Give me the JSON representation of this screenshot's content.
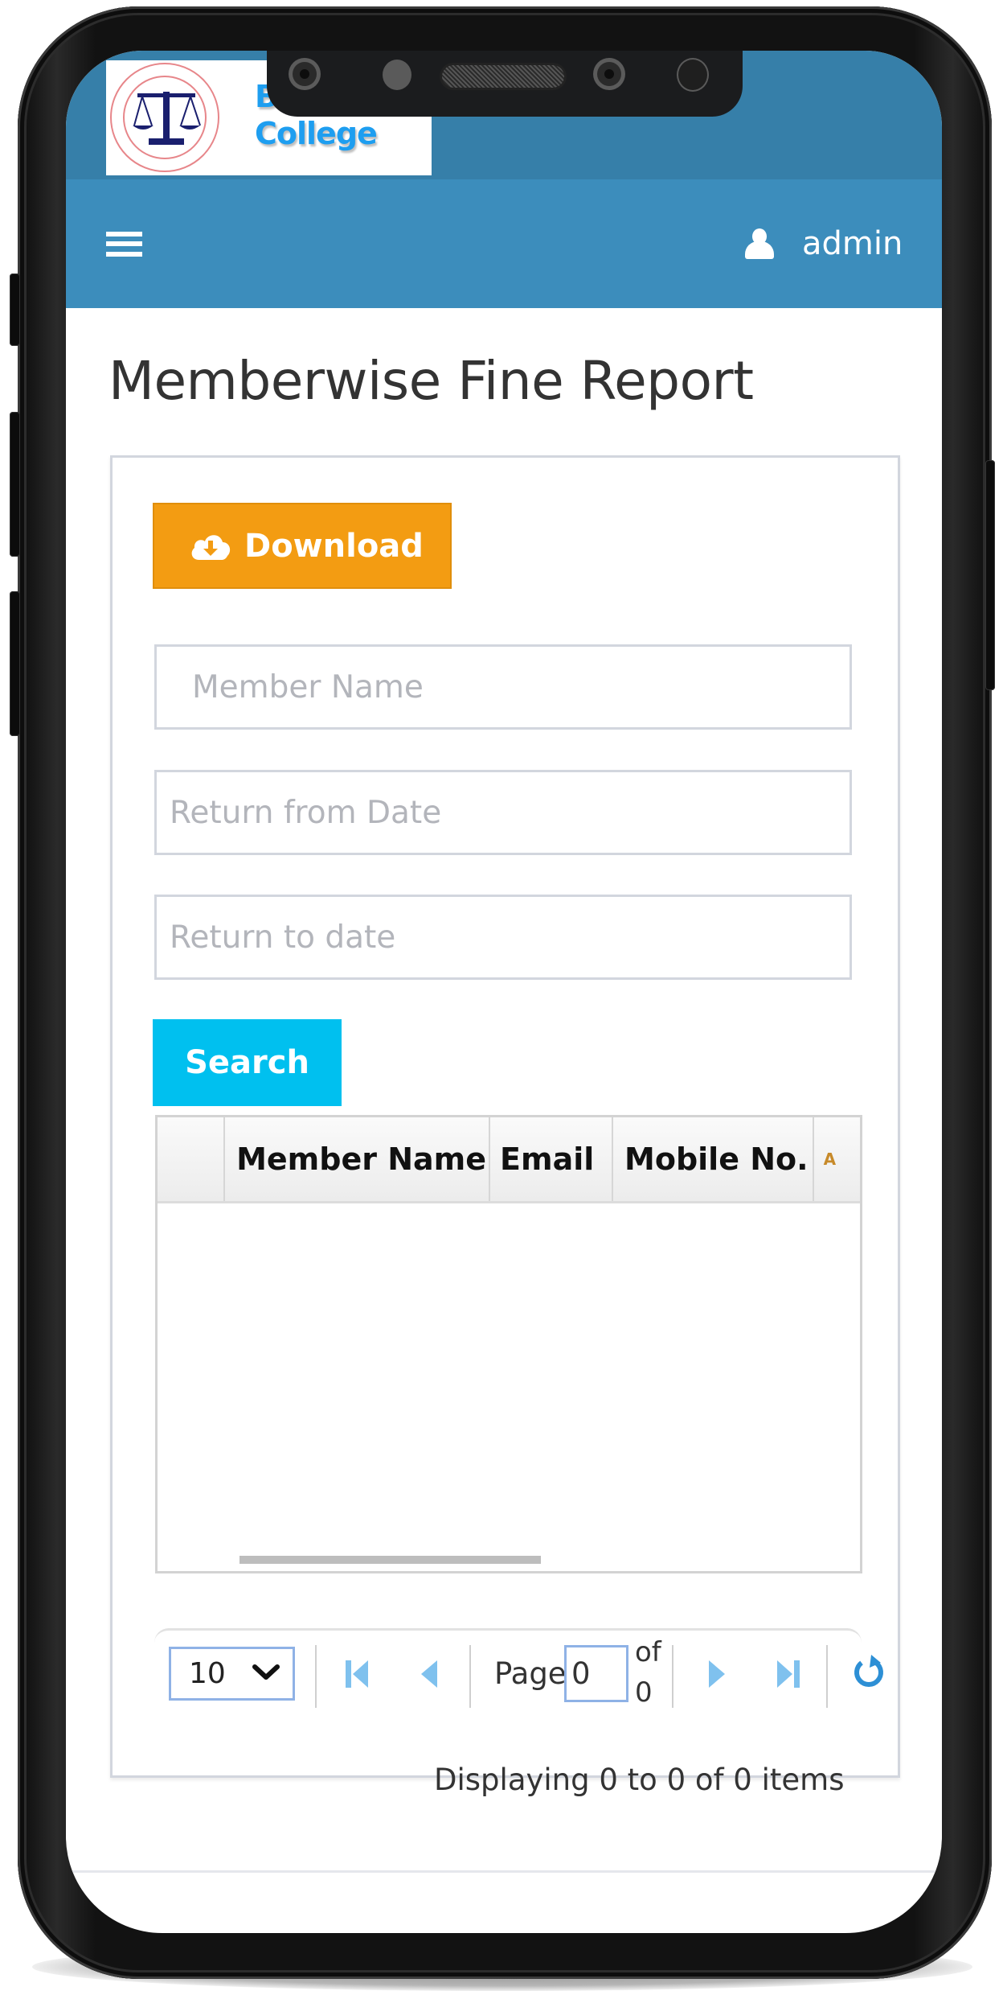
{
  "brand": {
    "college_name_line1": "Be",
    "college_name_line2": "College",
    "logo_alt": "law-college-seal"
  },
  "navbar": {
    "menu_icon": "hamburger-icon",
    "user_icon": "user-icon",
    "username": "admin"
  },
  "page": {
    "title": "Memberwise Fine Report"
  },
  "toolbar": {
    "download_label": "Download",
    "download_icon": "cloud-download-icon",
    "search_label": "Search"
  },
  "filters": {
    "member_name": {
      "value": "",
      "placeholder": "Member Name"
    },
    "return_from_date": {
      "value": "",
      "placeholder": "Return from Date"
    },
    "return_to_date": {
      "value": "",
      "placeholder": "Return to date"
    }
  },
  "grid": {
    "columns": [
      "",
      "Member Name",
      "Email",
      "Mobile No.",
      "A"
    ],
    "rows": []
  },
  "pager": {
    "page_size": "10",
    "page_label": "Page",
    "current_page": "0",
    "of_label": "of",
    "total_pages": "0",
    "display_info": "Displaying 0 to 0 of 0 items"
  },
  "colors": {
    "header_dark": "#367fa9",
    "navbar": "#3c8dbc",
    "download_button": "#f39c12",
    "search_button": "#00c0ef",
    "pager_icon": "#7fc1ee",
    "refresh_icon": "#2d8fd5"
  }
}
